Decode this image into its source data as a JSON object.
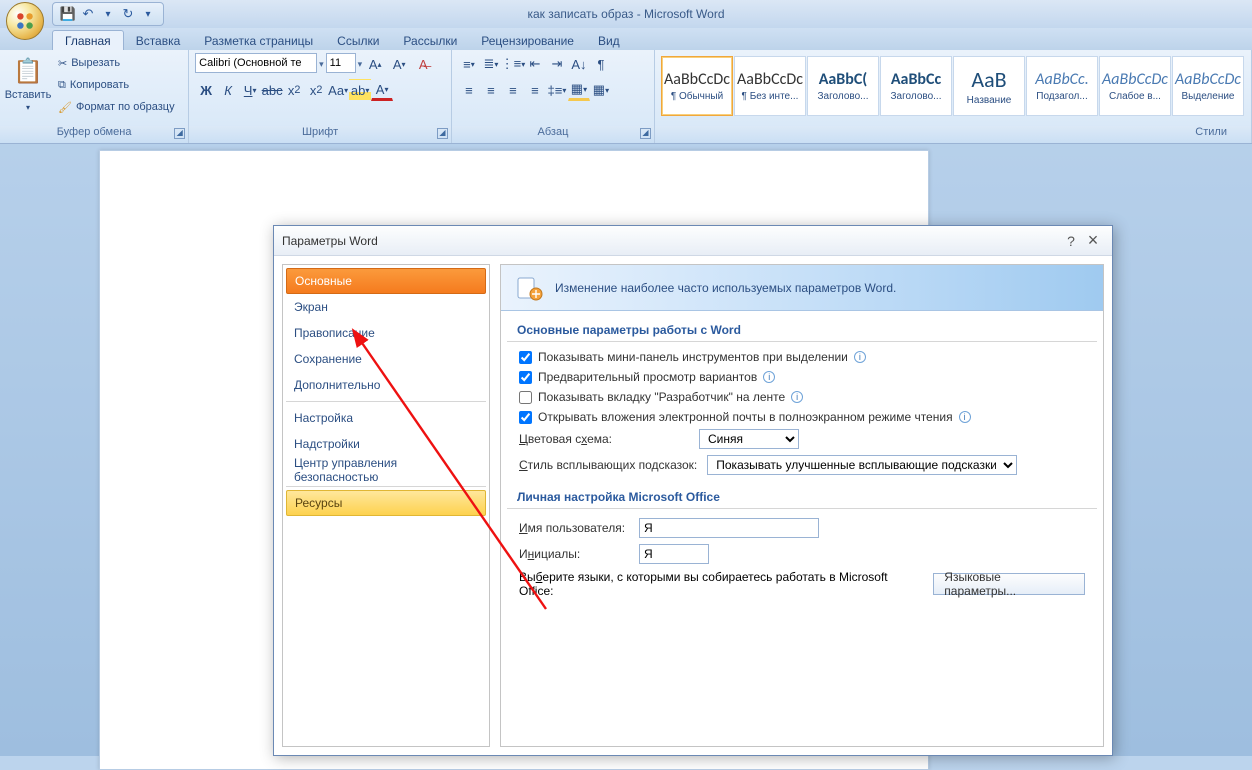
{
  "title": "как записать образ - Microsoft Word",
  "qat": {
    "save": "💾",
    "undo": "↶",
    "redo": "↻"
  },
  "tabs": [
    "Главная",
    "Вставка",
    "Разметка страницы",
    "Ссылки",
    "Рассылки",
    "Рецензирование",
    "Вид"
  ],
  "clipboard": {
    "paste_label": "Вставить",
    "cut": "Вырезать",
    "copy": "Копировать",
    "painter": "Формат по образцу",
    "group_label": "Буфер обмена"
  },
  "font": {
    "name": "Calibri (Основной те",
    "size": "11",
    "group_label": "Шрифт"
  },
  "paragraph": {
    "group_label": "Абзац"
  },
  "styles": {
    "group_label": "Стили",
    "items": [
      {
        "preview": "AaBbCcDc",
        "label": "¶ Обычный",
        "sel": true,
        "cls": ""
      },
      {
        "preview": "AaBbCcDc",
        "label": "¶ Без инте...",
        "sel": false,
        "cls": ""
      },
      {
        "preview": "AaBbC(",
        "label": "Заголово...",
        "sel": false,
        "cls": "h"
      },
      {
        "preview": "AaBbCc",
        "label": "Заголово...",
        "sel": false,
        "cls": "h"
      },
      {
        "preview": "AaB",
        "label": "Название",
        "sel": false,
        "cls": "t"
      },
      {
        "preview": "AaBbCc.",
        "label": "Подзагол...",
        "sel": false,
        "cls": "it"
      },
      {
        "preview": "AaBbCcDc",
        "label": "Слабое в...",
        "sel": false,
        "cls": "it"
      },
      {
        "preview": "AaBbCcDc",
        "label": "Выделение",
        "sel": false,
        "cls": "it"
      }
    ]
  },
  "dialog": {
    "title": "Параметры Word",
    "help": "?",
    "close": "×",
    "nav": [
      {
        "label": "Основные",
        "kind": "sel"
      },
      {
        "label": "Экран",
        "kind": ""
      },
      {
        "label": "Правописание",
        "kind": ""
      },
      {
        "label": "Сохранение",
        "kind": ""
      },
      {
        "label": "Дополнительно",
        "kind": ""
      },
      {
        "label": "__sep__",
        "kind": "sep"
      },
      {
        "label": "Настройка",
        "kind": ""
      },
      {
        "label": "Надстройки",
        "kind": ""
      },
      {
        "label": "Центр управления безопасностью",
        "kind": ""
      },
      {
        "label": "__sep__",
        "kind": "sep"
      },
      {
        "label": "Ресурсы",
        "kind": "res"
      }
    ],
    "head_text": "Изменение наиболее часто используемых параметров Word.",
    "section1_title": "Основные параметры работы с Word",
    "opts": [
      {
        "checked": true,
        "text": "Показывать мини-панель инструментов при выделении",
        "info": true
      },
      {
        "checked": true,
        "text": "Предварительный просмотр вариантов",
        "info": true,
        "u": "в"
      },
      {
        "checked": false,
        "text": "Показывать вкладку \"Разработчик\" на ленте",
        "info": true,
        "u": "Р"
      },
      {
        "checked": true,
        "text": "Открывать вложения электронной почты в полноэкранном режиме чтения",
        "info": true,
        "u": "л"
      }
    ],
    "color_scheme_label": "Цветовая схема:",
    "color_scheme_value": "Синяя",
    "tooltip_label": "Стиль всплывающих подсказок:",
    "tooltip_value": "Показывать улучшенные всплывающие подсказки",
    "section2_title": "Личная настройка Microsoft Office",
    "username_label": "Имя пользователя:",
    "username_value": "Я",
    "initials_label": "Инициалы:",
    "initials_value": "Я",
    "lang_text": "Выберите языки, с которыми вы собираетесь работать в Microsoft Office:",
    "lang_button": "Языковые параметры..."
  }
}
